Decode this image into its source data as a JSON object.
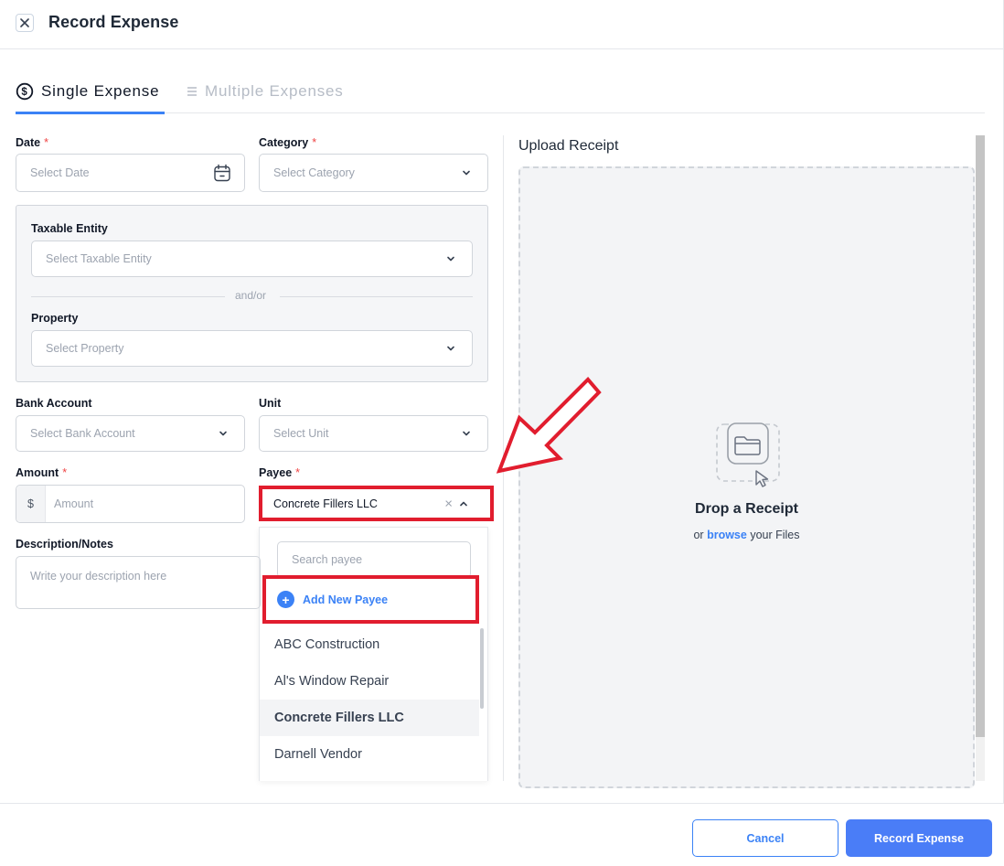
{
  "header": {
    "title": "Record Expense",
    "close_icon": "close-icon"
  },
  "tabs": [
    {
      "label": "Single Expense",
      "icon": "dollar-circle-icon",
      "active": true
    },
    {
      "label": "Multiple Expenses",
      "icon": "list-icon",
      "active": false
    }
  ],
  "form": {
    "date": {
      "label": "Date",
      "required": "*",
      "placeholder": "Select Date"
    },
    "category": {
      "label": "Category",
      "required": "*",
      "placeholder": "Select Category"
    },
    "taxable_entity": {
      "label": "Taxable Entity",
      "placeholder": "Select Taxable Entity"
    },
    "andor": "and/or",
    "property": {
      "label": "Property",
      "placeholder": "Select Property"
    },
    "bank_account": {
      "label": "Bank Account",
      "placeholder": "Select Bank Account"
    },
    "unit": {
      "label": "Unit",
      "placeholder": "Select Unit"
    },
    "amount": {
      "label": "Amount",
      "required": "*",
      "prefix": "$",
      "placeholder": "Amount"
    },
    "payee": {
      "label": "Payee",
      "required": "*",
      "value": "Concrete Fillers LLC",
      "search_placeholder": "Search payee",
      "add_label": "Add New Payee",
      "options": [
        "ABC Construction",
        "Al's Window Repair",
        "Concrete Fillers LLC",
        "Darnell Vendor"
      ],
      "selected": "Concrete Fillers LLC"
    },
    "description": {
      "label": "Description/Notes",
      "placeholder": "Write your description here"
    }
  },
  "upload": {
    "title": "Upload Receipt",
    "drop_title": "Drop a Receipt",
    "or_text": "or",
    "browse_text": "browse",
    "files_text": "your Files"
  },
  "footer": {
    "cancel_label": "Cancel",
    "record_label": "Record Expense"
  },
  "colors": {
    "accent": "#3b82f6",
    "highlight": "#e11d2e",
    "required": "#ef4444"
  }
}
